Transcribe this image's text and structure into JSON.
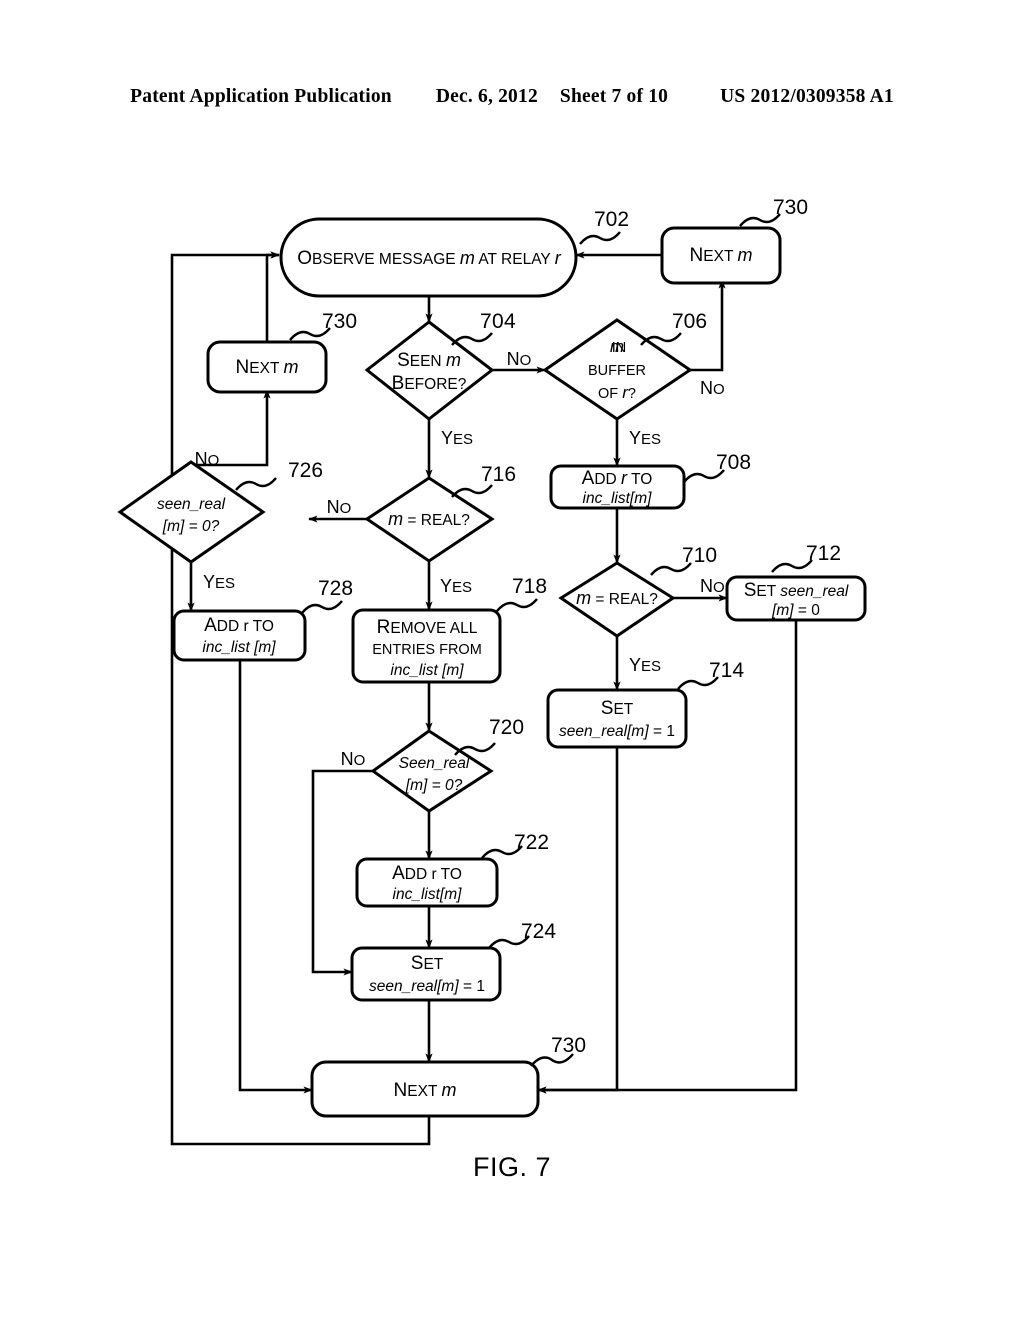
{
  "header": {
    "publication": "Patent Application Publication",
    "date": "Dec. 6, 2012",
    "sheet": "Sheet 7 of 10",
    "docnum": "US 2012/0309358 A1"
  },
  "figure": {
    "caption": "FIG. 7"
  },
  "nodes": {
    "n702": {
      "ref": "702",
      "shape": "stadium",
      "text_parts": [
        "O",
        "BSERVE MESSAGE ",
        "m",
        " AT RELAY ",
        "r"
      ]
    },
    "n730_top": {
      "ref": "730",
      "shape": "rounded-rect",
      "line1_a": "N",
      "line1_b": "EXT ",
      "line1_c": "m"
    },
    "n730_left": {
      "ref": "730",
      "shape": "rounded-rect",
      "line1_a": "N",
      "line1_b": "EXT ",
      "line1_c": "m"
    },
    "n730_bottom": {
      "ref": "730",
      "shape": "rounded-rect",
      "line1_a": "N",
      "line1_b": "EXT ",
      "line1_c": "m"
    },
    "n704": {
      "ref": "704",
      "shape": "diamond",
      "line1_a": "S",
      "line1_b": "EEN ",
      "line1_c": "m",
      "line2_a": "B",
      "line2_b": "EFORE?"
    },
    "n706": {
      "ref": "706",
      "shape": "diamond",
      "line1_a": "m",
      "line1_b": " IN",
      "line2": "BUFFER",
      "line3_a": "OF ",
      "line3_b": "r",
      "line3_c": "?"
    },
    "n708": {
      "ref": "708",
      "shape": "rounded-rect",
      "line1_a": "A",
      "line1_b": "DD ",
      "line1_c": "r",
      "line1_d": " TO",
      "line2": "inc_list[m]"
    },
    "n710": {
      "ref": "710",
      "shape": "diamond",
      "line1_a": "m",
      "line1_b": " = REAL?"
    },
    "n712": {
      "ref": "712",
      "shape": "rounded-rect",
      "line1_a": "S",
      "line1_b": "ET ",
      "line1_c": "seen_real",
      "line2_a": "[m]",
      "line2_b": " = 0"
    },
    "n714": {
      "ref": "714",
      "shape": "rounded-rect",
      "line1_a": "S",
      "line1_b": "ET",
      "line2": "seen_real[m]",
      "line2_b": " = 1"
    },
    "n716": {
      "ref": "716",
      "shape": "diamond",
      "line1_a": "m",
      "line1_b": " = REAL?"
    },
    "n718": {
      "ref": "718",
      "shape": "rounded-rect",
      "line1_a": "R",
      "line1_b": "EMOVE ALL",
      "line2": "ENTRIES FROM",
      "line3": "inc_list [m]"
    },
    "n720": {
      "ref": "720",
      "shape": "diamond",
      "line1": "Seen_real",
      "line2": "[m] = 0?"
    },
    "n722": {
      "ref": "722",
      "shape": "rounded-rect",
      "line1_a": "A",
      "line1_b": "DD r ",
      "line1_c": "TO",
      "line2": "inc_list[m]"
    },
    "n724": {
      "ref": "724",
      "shape": "rounded-rect",
      "line1_a": "S",
      "line1_b": "ET",
      "line2": "seen_real[m]",
      "line2_b": " = 1"
    },
    "n726": {
      "ref": "726",
      "shape": "diamond",
      "line1": "seen_real",
      "line2": "[m] = 0?"
    },
    "n728": {
      "ref": "728",
      "shape": "rounded-rect",
      "line1_a": "A",
      "line1_b": "DD r ",
      "line1_c": "TO",
      "line2": "inc_list [m]"
    }
  },
  "edge_labels": {
    "e704_no": "No",
    "e704_yes": "Y",
    "e704_yes_b": "ES",
    "e706_no": "No",
    "e706_yes": "Y",
    "e706_yes_b": "ES",
    "e710_no": "No",
    "e710_yes": "Y",
    "e710_yes_b": "ES",
    "e716_no": "No",
    "e716_yes": "Y",
    "e716_yes_b": "ES",
    "e720_no": "No",
    "e726_no": "No",
    "e726_yes": "Y",
    "e726_yes_b": "ES"
  },
  "colors": {
    "stroke": "#000000",
    "background": "#ffffff"
  }
}
